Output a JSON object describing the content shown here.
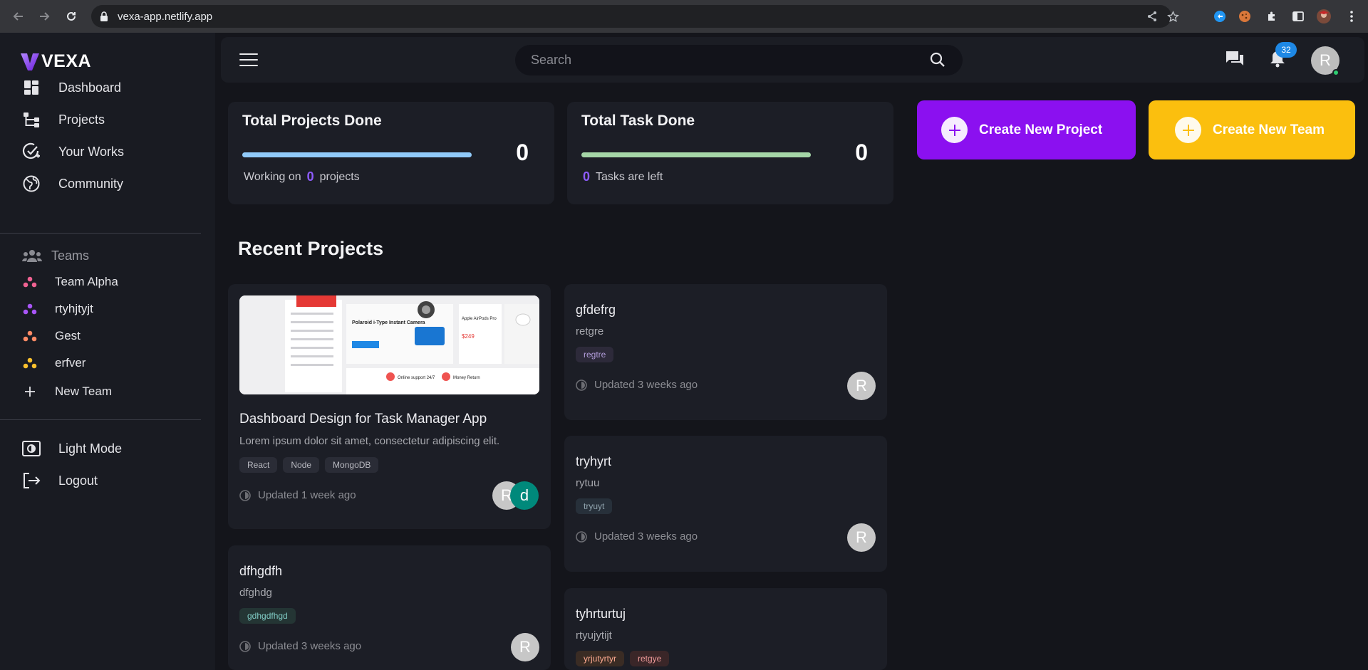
{
  "browser": {
    "url": "vexa-app.netlify.app"
  },
  "brand": {
    "name": "VEXA",
    "accent": "#7c3aed"
  },
  "sidebar": {
    "nav": [
      {
        "label": "Dashboard",
        "icon": "dashboard-icon"
      },
      {
        "label": "Projects",
        "icon": "projects-icon"
      },
      {
        "label": "Your Works",
        "icon": "your-works-icon"
      },
      {
        "label": "Community",
        "icon": "globe-icon"
      }
    ],
    "teams_header": "Teams",
    "teams": [
      {
        "label": "Team Alpha",
        "color": "#f06292"
      },
      {
        "label": "rtyhjtyjt",
        "color": "#a855f7"
      },
      {
        "label": "Gest",
        "color": "#ff8a65"
      },
      {
        "label": "erfver",
        "color": "#fbc02d"
      }
    ],
    "new_team": "New Team",
    "light_mode": "Light Mode",
    "logout": "Logout"
  },
  "topbar": {
    "search_placeholder": "Search",
    "notification_count": "32",
    "user_initial": "R"
  },
  "stats": {
    "projects": {
      "title": "Total Projects Done",
      "value": "0",
      "prefix": "Working on",
      "count": "0",
      "suffix": "projects",
      "bar_color": "#90caf9",
      "progress": 1.0
    },
    "tasks": {
      "title": "Total Task Done",
      "value": "0",
      "count": "0",
      "suffix": "Tasks are left",
      "bar_color": "#a5d6a7",
      "progress": 1.0
    }
  },
  "actions": {
    "create_project": {
      "label": "Create New Project",
      "color": "#8b10f0"
    },
    "create_team": {
      "label": "Create New Team",
      "color": "#fbbf0e"
    }
  },
  "recent": {
    "title": "Recent Projects",
    "projects": [
      {
        "title": "Dashboard Design for Task Manager App",
        "desc": "Lorem ipsum dolor sit amet, consectetur adipiscing elit.",
        "tags": [
          "React",
          "Node",
          "MongoDB"
        ],
        "updated": "Updated 1 week ago",
        "members": [
          "R",
          "d"
        ]
      },
      {
        "title": "gfdefrg",
        "desc": "retgre",
        "tags": [
          "regtre"
        ],
        "updated": "Updated 3 weeks ago",
        "members": [
          "R"
        ]
      },
      {
        "title": "tryhyrt",
        "desc": "rytuu",
        "tags": [
          "tryuyt"
        ],
        "updated": "Updated 3 weeks ago",
        "members": [
          "R"
        ]
      },
      {
        "title": "dfhgdfh",
        "desc": "dfghdg",
        "tags": [
          "gdhgdfhgd"
        ],
        "updated": "Updated 3 weeks ago",
        "members": [
          "R"
        ]
      },
      {
        "title": "tyhrturtuj",
        "desc": "rtyujytijt",
        "tags": [
          "yrjutyrtyr",
          "retgye"
        ]
      }
    ]
  },
  "thumbnail": {
    "texts": [
      "Polaroid i-Type Instant Camera",
      "Apple AirPods Pro",
      "Online support 24/7",
      "Money Return"
    ]
  }
}
